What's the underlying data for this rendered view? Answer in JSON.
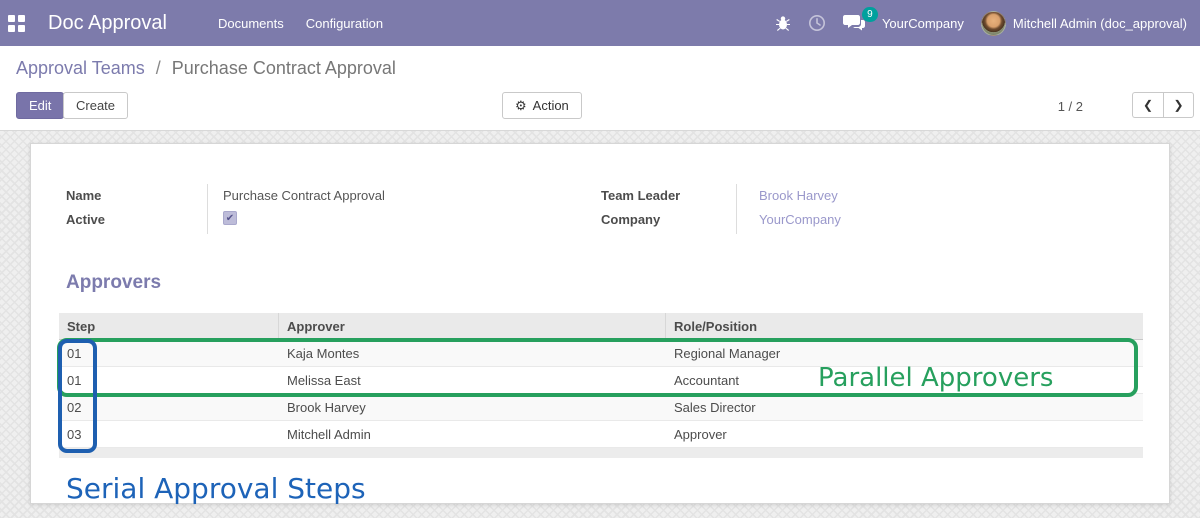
{
  "navbar": {
    "brand": "Doc Approval",
    "menus": {
      "documents": "Documents",
      "configuration": "Configuration"
    },
    "message_count": "9",
    "company": "YourCompany",
    "user": "Mitchell Admin (doc_approval)"
  },
  "breadcrumb": {
    "parent": "Approval Teams",
    "separator": "/",
    "current": "Purchase Contract Approval"
  },
  "toolbar": {
    "edit_label": "Edit",
    "create_label": "Create",
    "action_label": "Action",
    "pager": "1 / 2"
  },
  "icons": {
    "gear": "⚙",
    "prev": "❮",
    "next": "❯",
    "check": "✔"
  },
  "form": {
    "name_label": "Name",
    "name_value": "Purchase Contract Approval",
    "active_label": "Active",
    "active_checked": true,
    "team_leader_label": "Team Leader",
    "team_leader_value": "Brook Harvey",
    "company_label": "Company",
    "company_value": "YourCompany",
    "section_title": "Approvers"
  },
  "table": {
    "columns": [
      "Step",
      "Approver",
      "Role/Position"
    ],
    "rows": [
      {
        "step": "01",
        "approver": "Kaja Montes",
        "role": "Regional Manager"
      },
      {
        "step": "01",
        "approver": "Melissa East",
        "role": "Accountant"
      },
      {
        "step": "02",
        "approver": "Brook Harvey",
        "role": "Sales Director"
      },
      {
        "step": "03",
        "approver": "Mitchell Admin",
        "role": "Approver"
      }
    ]
  },
  "annotations": {
    "parallel_label": "Parallel Approvers",
    "serial_label": "Serial Approval Steps",
    "green_color": "#27a05e",
    "blue_color": "#1d63b8"
  }
}
